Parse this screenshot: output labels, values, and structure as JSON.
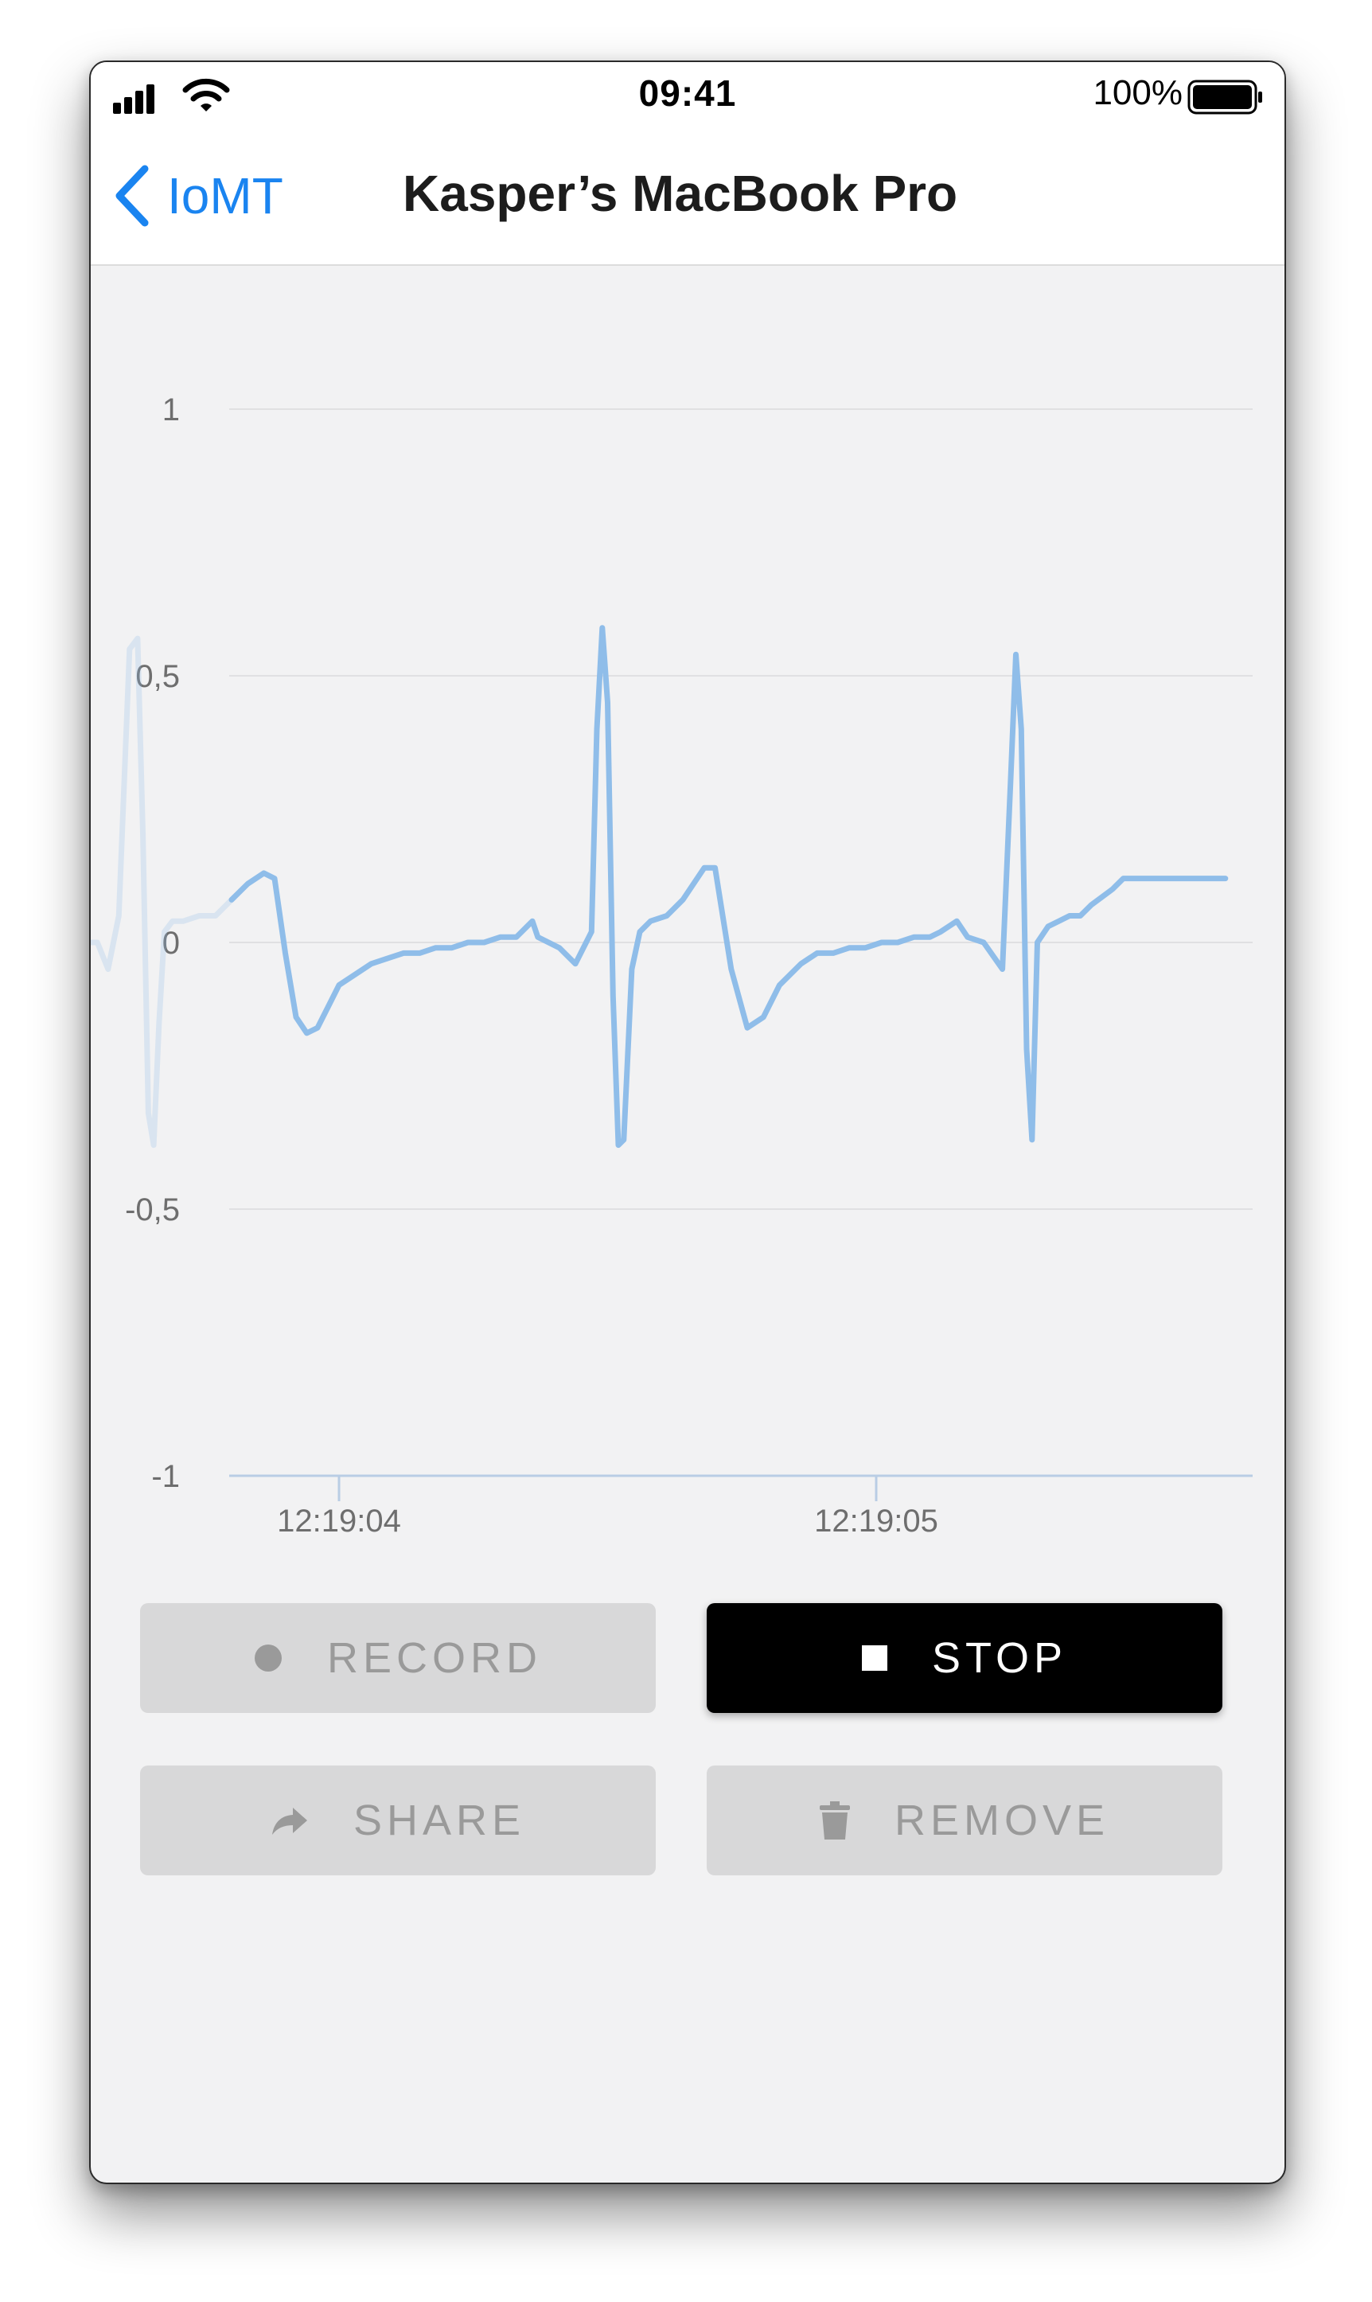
{
  "status_bar": {
    "time": "09:41",
    "battery": "100%"
  },
  "nav": {
    "back_label": "IoMT",
    "title": "Kasper’s MacBook Pro"
  },
  "chart_data": {
    "type": "line",
    "series_color": "#8fbde9",
    "ylim": [
      -1,
      1
    ],
    "y_ticks": [
      "1",
      "0,5",
      "0",
      "-0,5",
      "-1"
    ],
    "y_tick_values": [
      1,
      0.5,
      0,
      -0.5,
      -1
    ],
    "x_ticks": [
      "12:19:04",
      "12:19:05"
    ],
    "xlim": [
      -0.2,
      1.65
    ],
    "x_tick_values": [
      0.0,
      1.0
    ],
    "grid": true,
    "faded_x": [
      -0.46,
      -0.45,
      -0.43,
      -0.41,
      -0.39,
      -0.375,
      -0.365,
      -0.355,
      -0.345,
      -0.335,
      -0.325,
      -0.31,
      -0.29,
      -0.26,
      -0.23,
      -0.2
    ],
    "faded_y": [
      0.0,
      0.0,
      -0.05,
      0.05,
      0.55,
      0.57,
      0.2,
      -0.32,
      -0.38,
      -0.15,
      0.02,
      0.04,
      0.04,
      0.05,
      0.05,
      0.08
    ],
    "x": [
      -0.2,
      -0.17,
      -0.14,
      -0.12,
      -0.1,
      -0.08,
      -0.06,
      -0.04,
      -0.02,
      0.0,
      0.03,
      0.06,
      0.09,
      0.12,
      0.15,
      0.18,
      0.21,
      0.24,
      0.27,
      0.3,
      0.33,
      0.35,
      0.36,
      0.37,
      0.39,
      0.41,
      0.44,
      0.47,
      0.48,
      0.49,
      0.5,
      0.51,
      0.52,
      0.53,
      0.545,
      0.56,
      0.58,
      0.61,
      0.64,
      0.68,
      0.7,
      0.73,
      0.76,
      0.79,
      0.82,
      0.86,
      0.89,
      0.92,
      0.95,
      0.98,
      1.01,
      1.04,
      1.07,
      1.09,
      1.1,
      1.12,
      1.15,
      1.17,
      1.2,
      1.235,
      1.25,
      1.26,
      1.27,
      1.28,
      1.29,
      1.3,
      1.32,
      1.34,
      1.36,
      1.38,
      1.4,
      1.44,
      1.46,
      1.49,
      1.51,
      1.53,
      1.55,
      1.57,
      1.6,
      1.63,
      1.65
    ],
    "y": [
      0.08,
      0.11,
      0.13,
      0.12,
      -0.02,
      -0.14,
      -0.17,
      -0.16,
      -0.12,
      -0.08,
      -0.06,
      -0.04,
      -0.03,
      -0.02,
      -0.02,
      -0.01,
      -0.01,
      -0.0,
      0.0,
      0.01,
      0.01,
      0.03,
      0.04,
      0.01,
      -0.0,
      -0.01,
      -0.04,
      0.02,
      0.4,
      0.59,
      0.45,
      -0.1,
      -0.38,
      -0.37,
      -0.05,
      0.02,
      0.04,
      0.05,
      0.08,
      0.14,
      0.14,
      -0.05,
      -0.16,
      -0.14,
      -0.08,
      -0.04,
      -0.02,
      -0.02,
      -0.01,
      -0.01,
      -0.0,
      0.0,
      0.01,
      0.01,
      0.01,
      0.02,
      0.04,
      0.01,
      -0.0,
      -0.05,
      0.3,
      0.54,
      0.4,
      -0.2,
      -0.37,
      0.0,
      0.03,
      0.04,
      0.05,
      0.05,
      0.07,
      0.1,
      0.12,
      0.12,
      0.12,
      0.12,
      0.12,
      0.12,
      0.12,
      0.12,
      0.12
    ]
  },
  "buttons": {
    "record": "RECORD",
    "stop": "STOP",
    "share": "SHARE",
    "remove": "REMOVE"
  }
}
